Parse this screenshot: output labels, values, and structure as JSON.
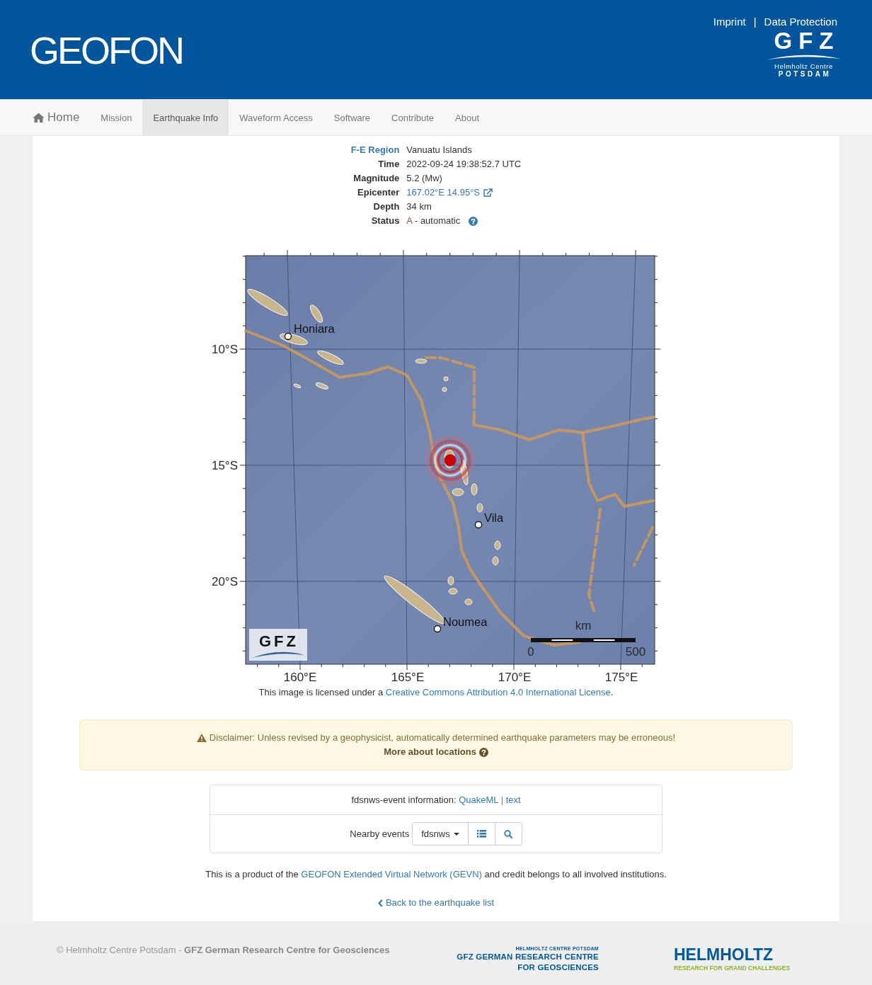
{
  "header": {
    "title": "GEOFON",
    "links": [
      "Imprint",
      "Data Protection"
    ],
    "separator": "|",
    "logo": {
      "mark": "GFZ",
      "line_1": "Helmholtz Centre",
      "line_2": "POTSDAM"
    }
  },
  "nav": {
    "items": [
      {
        "label": "Home",
        "kind": "home",
        "selected": false
      },
      {
        "label": "Mission",
        "kind": "link",
        "selected": false
      },
      {
        "label": "Earthquake Info",
        "kind": "link",
        "selected": true
      },
      {
        "label": "Waveform Access",
        "kind": "link",
        "selected": false
      },
      {
        "label": "Software",
        "kind": "link",
        "selected": false
      },
      {
        "label": "Contribute",
        "kind": "link",
        "selected": false
      },
      {
        "label": "About",
        "kind": "link",
        "selected": false
      }
    ]
  },
  "event": {
    "fields": [
      {
        "label": "F-E Region",
        "kind": "label_link",
        "value": "Vanuatu Islands"
      },
      {
        "label": "Time",
        "kind": "plain",
        "value": "2022-09-24 19:38:52.7 UTC"
      },
      {
        "label": "Magnitude",
        "kind": "plain",
        "value": "5.2 (Mw)"
      },
      {
        "label": "Epicenter",
        "kind": "value_link",
        "value": "167.02°E 14.95°S"
      },
      {
        "label": "Depth",
        "kind": "plain",
        "value": "34 km"
      },
      {
        "label": "Status",
        "kind": "status",
        "code": "A",
        "value": "- automatic"
      }
    ]
  },
  "map": {
    "lat_labels": [
      "10°S",
      "15°S",
      "20°S"
    ],
    "lon_labels": [
      "160°E",
      "165°E",
      "170°E",
      "175°E"
    ],
    "places": [
      "Honiara",
      "Vila",
      "Noumea"
    ],
    "scale": {
      "unit": "km",
      "start": "0",
      "end": "500"
    },
    "logo": "GFZ",
    "license": {
      "before": "This image is licensed under a",
      "link": "Creative Commons Attribution 4.0 International License",
      "after": "."
    }
  },
  "disclaimer": {
    "text": "Disclaimer: Unless revised by a geophysicist, automatically determined earthquake parameters may be erroneous!",
    "link": "More about locations"
  },
  "fdsn": {
    "label": "fdsnws-event information:",
    "formats": [
      "QuakeML",
      "text"
    ],
    "separator": "|",
    "nearby_label": "Nearby events",
    "dropdown": "fdsnws"
  },
  "credit": {
    "before": "This is a product of the",
    "link": "GEOFON Extended Virtual Network (GEVN)",
    "after": "and credit belongs to all involved institutions."
  },
  "back_link": "Back to the earthquake list",
  "footer": {
    "copyright": "© Helmholtz Centre Potsdam - **GFZ German Research Centre for Geosciences**",
    "gfz_logo": {
      "line_1": "HELMHOLTZ CENTRE POTSDAM",
      "line_2": "GFZ GERMAN RESEARCH CENTRE",
      "line_3": "FOR GEOSCIENCES"
    },
    "helmholtz_logo": {
      "name": "HELMHOLTZ",
      "tagline": "RESEARCH FOR GRAND CHALLENGES"
    }
  }
}
